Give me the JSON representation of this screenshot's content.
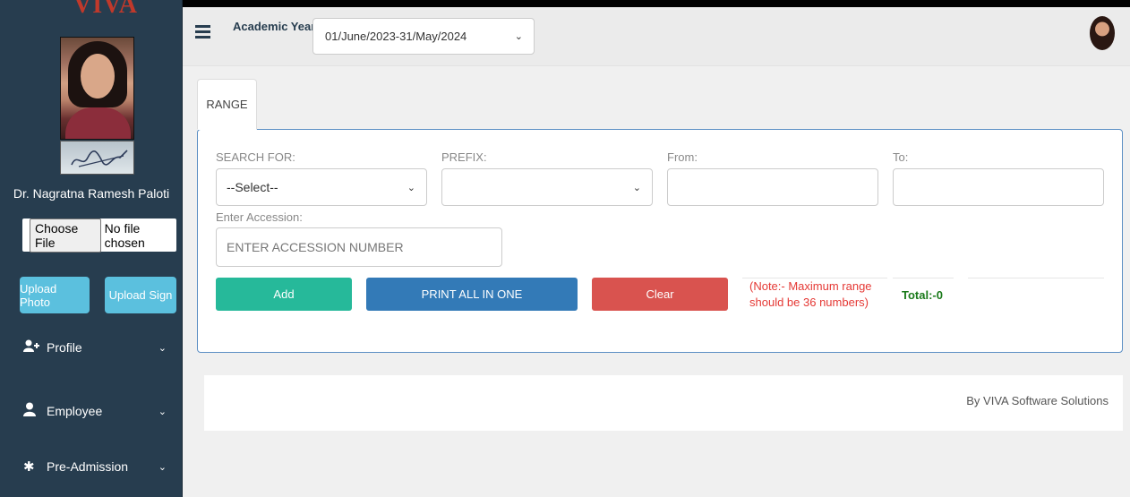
{
  "sidebar": {
    "logo_text": "VIVA",
    "user_name": "Dr. Nagratna Ramesh Paloti",
    "file_input": {
      "button_label": "Choose File",
      "status": "No file chosen"
    },
    "upload_photo_label": "Upload Photo",
    "upload_sign_label": "Upload Sign",
    "menu": [
      {
        "label": "Profile",
        "icon": "user-plus-icon"
      },
      {
        "label": "Employee",
        "icon": "user-icon"
      },
      {
        "label": "Pre-Admission",
        "icon": "asterisk-icon"
      }
    ]
  },
  "header": {
    "academic_year_label": "Academic Year",
    "academic_year_value": "01/June/2023-31/May/2024"
  },
  "tabs": [
    {
      "label": "RANGE"
    }
  ],
  "form": {
    "search_for_label": "SEARCH FOR:",
    "search_for_value": "--Select--",
    "prefix_label": "PREFIX:",
    "prefix_value": "",
    "from_label": "From:",
    "from_value": "",
    "to_label": "To:",
    "to_value": "",
    "accession_label": "Enter Accession:",
    "accession_placeholder": "ENTER ACCESSION NUMBER"
  },
  "actions": {
    "add_label": "Add",
    "print_label": "PRINT ALL IN ONE",
    "clear_label": "Clear",
    "note": "(Note:- Maximum range should be 36 numbers)",
    "total": "Total:-0"
  },
  "footer": {
    "text": "By VIVA Software Solutions"
  },
  "colors": {
    "sidebar": "#273d4f",
    "add": "#26b99a",
    "print": "#337ab7",
    "clear": "#d9534f",
    "upload": "#5bc0de",
    "note": "#e53935",
    "total": "#1a7a1a"
  }
}
